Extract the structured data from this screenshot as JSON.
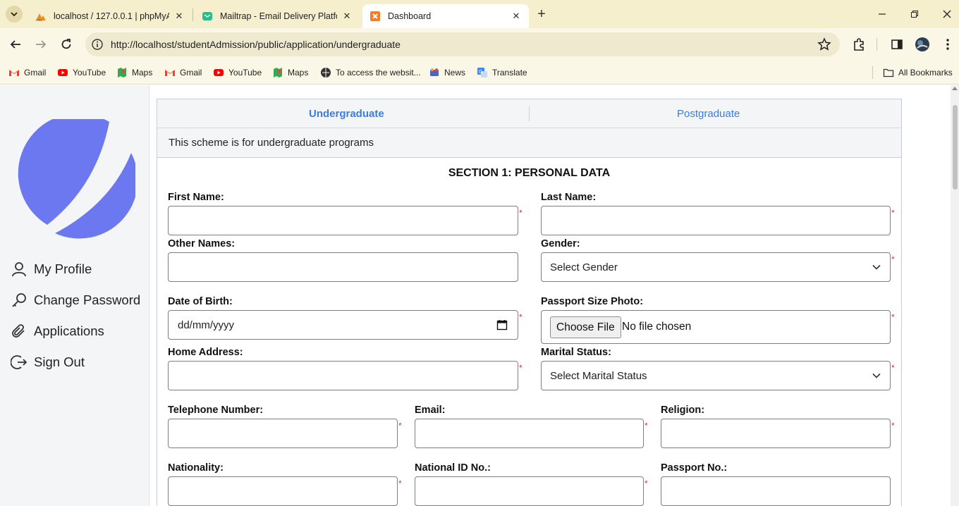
{
  "browser": {
    "tabs": [
      {
        "title": "localhost / 127.0.0.1 | phpMyAdmin"
      },
      {
        "title": "Mailtrap - Email Delivery Platform"
      },
      {
        "title": "Dashboard"
      }
    ],
    "url": "http://localhost/studentAdmission/public/application/undergraduate",
    "bookmarks": [
      "Gmail",
      "YouTube",
      "Maps",
      "Gmail",
      "YouTube",
      "Maps",
      "To access the websit...",
      "News",
      "Translate"
    ],
    "all_bookmarks": "All Bookmarks"
  },
  "sidebar": {
    "items": [
      {
        "label": "My Profile",
        "icon": "user-icon"
      },
      {
        "label": "Change Password",
        "icon": "key-icon"
      },
      {
        "label": "Applications",
        "icon": "paperclip-icon"
      },
      {
        "label": "Sign Out",
        "icon": "sign-out-icon"
      }
    ]
  },
  "form": {
    "tabs": {
      "undergraduate": "Undergraduate",
      "postgraduate": "Postgraduate"
    },
    "scheme_note": "This scheme is for undergraduate programs",
    "section_title": "SECTION 1: PERSONAL DATA",
    "labels": {
      "first_name": "First Name:",
      "last_name": "Last Name:",
      "other_names": "Other Names:",
      "gender": "Gender:",
      "dob": "Date of Birth:",
      "photo": "Passport Size Photo:",
      "address": "Home Address:",
      "marital": "Marital Status:",
      "telephone": "Telephone Number:",
      "email": "Email:",
      "religion": "Religion:",
      "nationality": "Nationality:",
      "national_id": "National ID No.:",
      "passport": "Passport No.:"
    },
    "gender_select": "Select Gender",
    "marital_select": "Select Marital Status",
    "date_placeholder": "dd/mm/yyyy",
    "file_button": "Choose File",
    "file_status": "No file chosen",
    "required_mark": "*"
  },
  "colors": {
    "accent": "#3b7ddd",
    "logo": "#6b78f0",
    "chrome": "#f6efce",
    "required": "#dd3333"
  }
}
